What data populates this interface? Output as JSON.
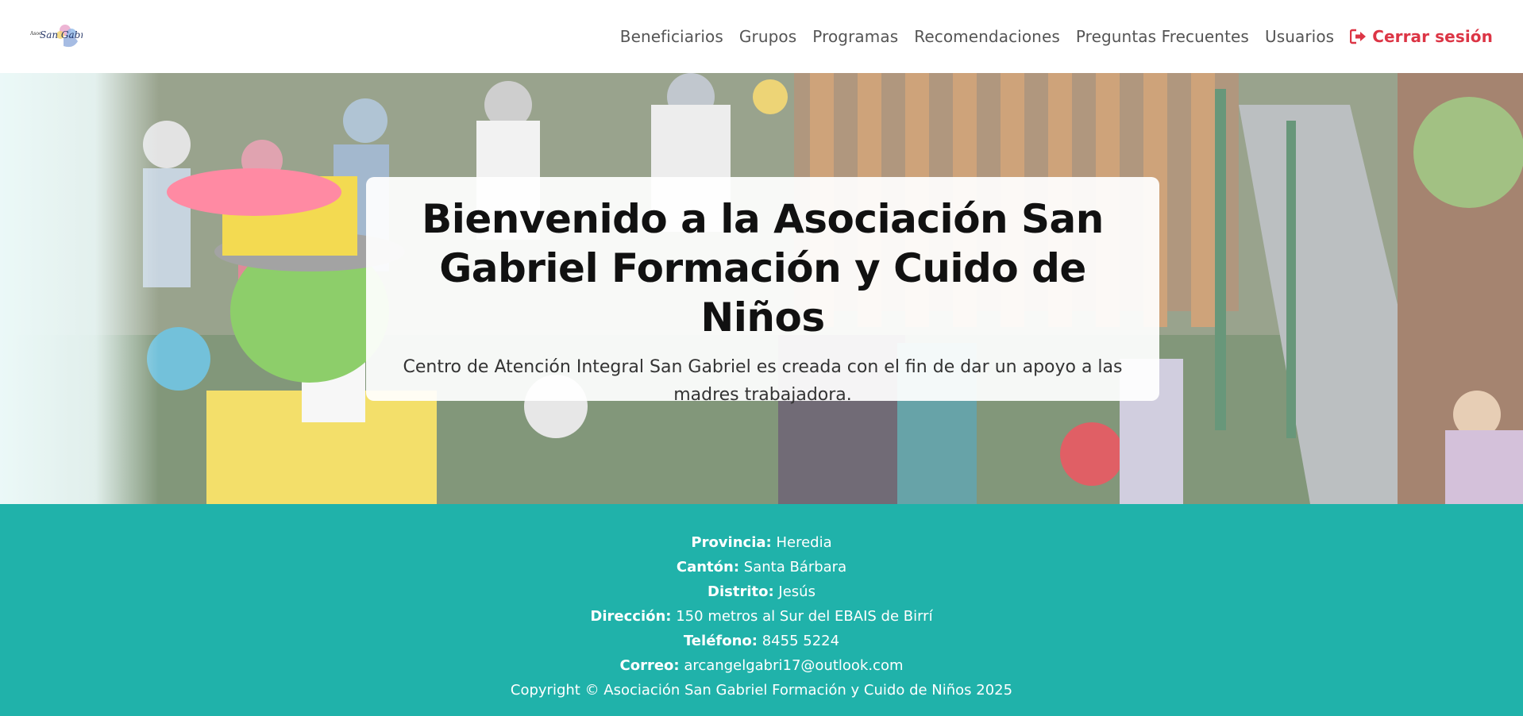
{
  "brand": {
    "logo_icon": "san-gabriel-logo",
    "logo_text": "San Gabriel"
  },
  "nav": {
    "items": [
      {
        "label": "Beneficiarios"
      },
      {
        "label": "Grupos"
      },
      {
        "label": "Programas"
      },
      {
        "label": "Recomendaciones"
      },
      {
        "label": "Preguntas Frecuentes"
      },
      {
        "label": "Usuarios"
      }
    ],
    "logout": {
      "label": "Cerrar sesión",
      "icon": "sign-out-icon"
    }
  },
  "hero": {
    "title": "Bienvenido a la Asociación San Gabriel Formación y Cuido de Niños",
    "subtitle": "Centro de Atención Integral San Gabriel es creada con el fin de dar un apoyo a las madres trabajadora."
  },
  "footer": {
    "provincia": {
      "label": "Provincia:",
      "value": "Heredia"
    },
    "canton": {
      "label": "Cantón:",
      "value": "Santa Bárbara"
    },
    "distrito": {
      "label": "Distrito:",
      "value": "Jesús"
    },
    "direccion": {
      "label": "Dirección:",
      "value": "150 metros al Sur del EBAIS de Birrí"
    },
    "telefono": {
      "label": "Teléfono:",
      "value": "8455 5224"
    },
    "correo": {
      "label": "Correo:",
      "value": "arcangelgabri17@outlook.com"
    },
    "copyright": "Copyright © Asociación San Gabriel Formación y Cuido de Niños 2025"
  },
  "colors": {
    "footer_bg": "#20b2aa",
    "logout": "#dc3545",
    "nav_text": "#555555"
  }
}
